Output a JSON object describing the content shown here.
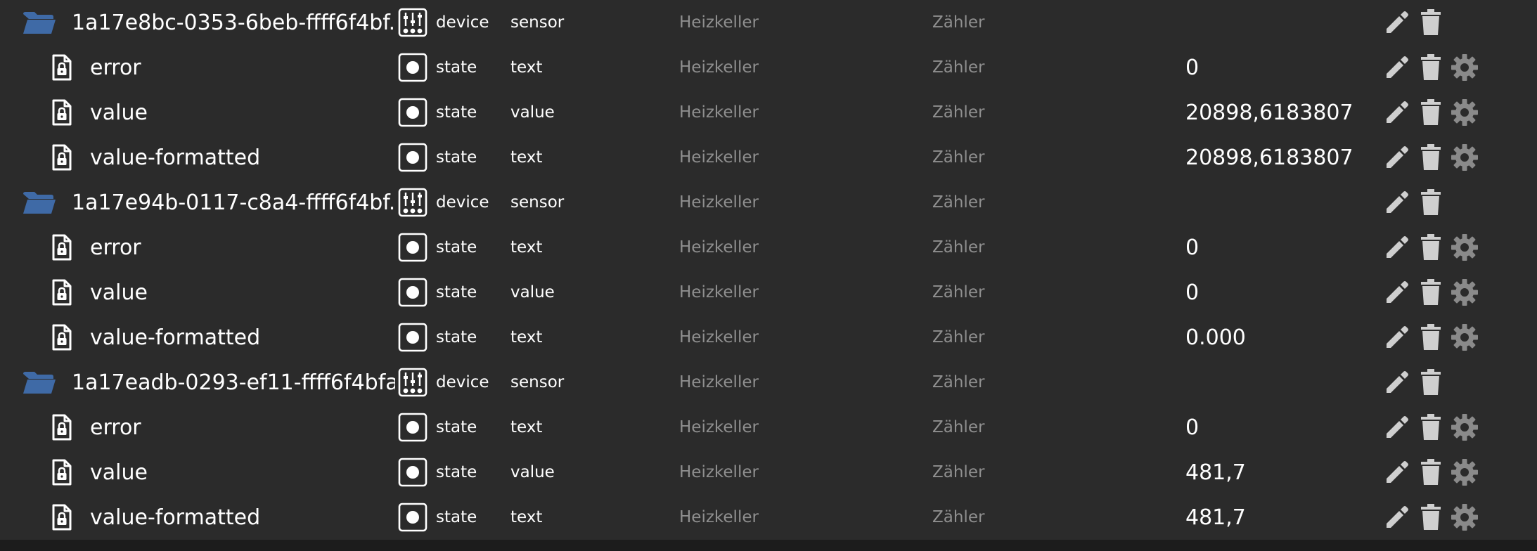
{
  "colors": {
    "background": "#2b2b2b",
    "folder": "#3f6aa6",
    "text": "#ffffff",
    "muted_text": "#8f8f8f",
    "action_icon": "#cfcfcf",
    "settings_icon": "#8a8a8a"
  },
  "rows": [
    {
      "kind": "folder",
      "icon": "folder-icon",
      "name": "1a17e8bc-0353-6beb-ffff6f4bf...",
      "type_icon": "device-sliders-icon",
      "type": "device",
      "role": "sensor",
      "room": "Heizkeller",
      "function": "Zähler",
      "value": "",
      "actions": [
        "edit-icon",
        "delete-icon"
      ]
    },
    {
      "kind": "state",
      "icon": "locked-file-icon",
      "name": "error",
      "type_icon": "state-icon",
      "type": "state",
      "role": "text",
      "room": "Heizkeller",
      "function": "Zähler",
      "value": "0",
      "actions": [
        "edit-icon",
        "delete-icon",
        "settings-icon"
      ]
    },
    {
      "kind": "state",
      "icon": "locked-file-icon",
      "name": "value",
      "type_icon": "state-icon",
      "type": "state",
      "role": "value",
      "room": "Heizkeller",
      "function": "Zähler",
      "value": "20898,6183807",
      "actions": [
        "edit-icon",
        "delete-icon",
        "settings-icon"
      ]
    },
    {
      "kind": "state",
      "icon": "locked-file-icon",
      "name": "value-formatted",
      "type_icon": "state-icon",
      "type": "state",
      "role": "text",
      "room": "Heizkeller",
      "function": "Zähler",
      "value": "20898,6183807",
      "actions": [
        "edit-icon",
        "delete-icon",
        "settings-icon"
      ]
    },
    {
      "kind": "folder",
      "icon": "folder-icon",
      "name": "1a17e94b-0117-c8a4-ffff6f4bf...",
      "type_icon": "device-sliders-icon",
      "type": "device",
      "role": "sensor",
      "room": "Heizkeller",
      "function": "Zähler",
      "value": "",
      "actions": [
        "edit-icon",
        "delete-icon"
      ]
    },
    {
      "kind": "state",
      "icon": "locked-file-icon",
      "name": "error",
      "type_icon": "state-icon",
      "type": "state",
      "role": "text",
      "room": "Heizkeller",
      "function": "Zähler",
      "value": "0",
      "actions": [
        "edit-icon",
        "delete-icon",
        "settings-icon"
      ]
    },
    {
      "kind": "state",
      "icon": "locked-file-icon",
      "name": "value",
      "type_icon": "state-icon",
      "type": "state",
      "role": "value",
      "room": "Heizkeller",
      "function": "Zähler",
      "value": "0",
      "actions": [
        "edit-icon",
        "delete-icon",
        "settings-icon"
      ]
    },
    {
      "kind": "state",
      "icon": "locked-file-icon",
      "name": "value-formatted",
      "type_icon": "state-icon",
      "type": "state",
      "role": "text",
      "room": "Heizkeller",
      "function": "Zähler",
      "value": "0.000",
      "actions": [
        "edit-icon",
        "delete-icon",
        "settings-icon"
      ]
    },
    {
      "kind": "folder",
      "icon": "folder-icon",
      "name": "1a17eadb-0293-ef11-ffff6f4bfa...",
      "type_icon": "device-sliders-icon",
      "type": "device",
      "role": "sensor",
      "room": "Heizkeller",
      "function": "Zähler",
      "value": "",
      "actions": [
        "edit-icon",
        "delete-icon"
      ]
    },
    {
      "kind": "state",
      "icon": "locked-file-icon",
      "name": "error",
      "type_icon": "state-icon",
      "type": "state",
      "role": "text",
      "room": "Heizkeller",
      "function": "Zähler",
      "value": "0",
      "actions": [
        "edit-icon",
        "delete-icon",
        "settings-icon"
      ]
    },
    {
      "kind": "state",
      "icon": "locked-file-icon",
      "name": "value",
      "type_icon": "state-icon",
      "type": "state",
      "role": "value",
      "room": "Heizkeller",
      "function": "Zähler",
      "value": "481,7",
      "actions": [
        "edit-icon",
        "delete-icon",
        "settings-icon"
      ]
    },
    {
      "kind": "state",
      "icon": "locked-file-icon",
      "name": "value-formatted",
      "type_icon": "state-icon",
      "type": "state",
      "role": "text",
      "room": "Heizkeller",
      "function": "Zähler",
      "value": "481,7",
      "actions": [
        "edit-icon",
        "delete-icon",
        "settings-icon"
      ]
    }
  ]
}
